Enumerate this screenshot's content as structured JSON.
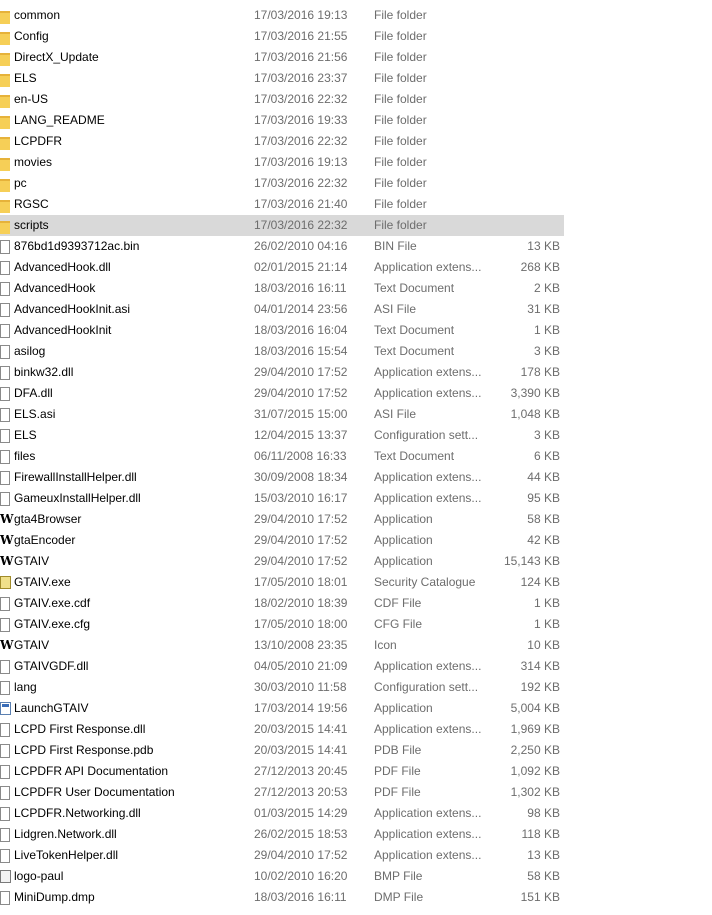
{
  "files": [
    {
      "name": "common",
      "date": "17/03/2016 19:13",
      "type": "File folder",
      "size": "",
      "icon": "folder-icon"
    },
    {
      "name": "Config",
      "date": "17/03/2016 21:55",
      "type": "File folder",
      "size": "",
      "icon": "folder-icon"
    },
    {
      "name": "DirectX_Update",
      "date": "17/03/2016 21:56",
      "type": "File folder",
      "size": "",
      "icon": "folder-icon"
    },
    {
      "name": "ELS",
      "date": "17/03/2016 23:37",
      "type": "File folder",
      "size": "",
      "icon": "folder-icon"
    },
    {
      "name": "en-US",
      "date": "17/03/2016 22:32",
      "type": "File folder",
      "size": "",
      "icon": "folder-icon"
    },
    {
      "name": "LANG_README",
      "date": "17/03/2016 19:33",
      "type": "File folder",
      "size": "",
      "icon": "folder-icon"
    },
    {
      "name": "LCPDFR",
      "date": "17/03/2016 22:32",
      "type": "File folder",
      "size": "",
      "icon": "folder-icon"
    },
    {
      "name": "movies",
      "date": "17/03/2016 19:13",
      "type": "File folder",
      "size": "",
      "icon": "folder-icon"
    },
    {
      "name": "pc",
      "date": "17/03/2016 22:32",
      "type": "File folder",
      "size": "",
      "icon": "folder-icon"
    },
    {
      "name": "RGSC",
      "date": "17/03/2016 21:40",
      "type": "File folder",
      "size": "",
      "icon": "folder-icon"
    },
    {
      "name": "scripts",
      "date": "17/03/2016 22:32",
      "type": "File folder",
      "size": "",
      "icon": "folder-icon",
      "selected": true
    },
    {
      "name": "876bd1d9393712ac.bin",
      "date": "26/02/2010 04:16",
      "type": "BIN File",
      "size": "13 KB",
      "icon": "file-icon"
    },
    {
      "name": "AdvancedHook.dll",
      "date": "02/01/2015 21:14",
      "type": "Application extens...",
      "size": "268 KB",
      "icon": "file-icon"
    },
    {
      "name": "AdvancedHook",
      "date": "18/03/2016 16:11",
      "type": "Text Document",
      "size": "2 KB",
      "icon": "file-icon"
    },
    {
      "name": "AdvancedHookInit.asi",
      "date": "04/01/2014 23:56",
      "type": "ASI File",
      "size": "31 KB",
      "icon": "file-icon"
    },
    {
      "name": "AdvancedHookInit",
      "date": "18/03/2016 16:04",
      "type": "Text Document",
      "size": "1 KB",
      "icon": "file-icon"
    },
    {
      "name": "asilog",
      "date": "18/03/2016 15:54",
      "type": "Text Document",
      "size": "3 KB",
      "icon": "file-icon"
    },
    {
      "name": "binkw32.dll",
      "date": "29/04/2010 17:52",
      "type": "Application extens...",
      "size": "178 KB",
      "icon": "file-icon"
    },
    {
      "name": "DFA.dll",
      "date": "29/04/2010 17:52",
      "type": "Application extens...",
      "size": "3,390 KB",
      "icon": "file-icon"
    },
    {
      "name": "ELS.asi",
      "date": "31/07/2015 15:00",
      "type": "ASI File",
      "size": "1,048 KB",
      "icon": "file-icon"
    },
    {
      "name": "ELS",
      "date": "12/04/2015 13:37",
      "type": "Configuration sett...",
      "size": "3 KB",
      "icon": "file-icon"
    },
    {
      "name": "files",
      "date": "06/11/2008 16:33",
      "type": "Text Document",
      "size": "6 KB",
      "icon": "file-icon"
    },
    {
      "name": "FirewallInstallHelper.dll",
      "date": "30/09/2008 18:34",
      "type": "Application extens...",
      "size": "44 KB",
      "icon": "file-icon"
    },
    {
      "name": "GameuxInstallHelper.dll",
      "date": "15/03/2010 16:17",
      "type": "Application extens...",
      "size": "95 KB",
      "icon": "file-icon"
    },
    {
      "name": "gta4Browser",
      "date": "29/04/2010 17:52",
      "type": "Application",
      "size": "58 KB",
      "icon": "gta-app-icon"
    },
    {
      "name": "gtaEncoder",
      "date": "29/04/2010 17:52",
      "type": "Application",
      "size": "42 KB",
      "icon": "gta-app-icon"
    },
    {
      "name": "GTAIV",
      "date": "29/04/2010 17:52",
      "type": "Application",
      "size": "15,143 KB",
      "icon": "gta-app-icon"
    },
    {
      "name": "GTAIV.exe",
      "date": "17/05/2010 18:01",
      "type": "Security Catalogue",
      "size": "124 KB",
      "icon": "security-catalogue-icon"
    },
    {
      "name": "GTAIV.exe.cdf",
      "date": "18/02/2010 18:39",
      "type": "CDF File",
      "size": "1 KB",
      "icon": "file-icon"
    },
    {
      "name": "GTAIV.exe.cfg",
      "date": "17/05/2010 18:00",
      "type": "CFG File",
      "size": "1 KB",
      "icon": "file-icon"
    },
    {
      "name": "GTAIV",
      "date": "13/10/2008 23:35",
      "type": "Icon",
      "size": "10 KB",
      "icon": "gta-app-icon"
    },
    {
      "name": "GTAIVGDF.dll",
      "date": "04/05/2010 21:09",
      "type": "Application extens...",
      "size": "314 KB",
      "icon": "file-icon"
    },
    {
      "name": "lang",
      "date": "30/03/2010 11:58",
      "type": "Configuration sett...",
      "size": "192 KB",
      "icon": "file-icon"
    },
    {
      "name": "LaunchGTAIV",
      "date": "17/03/2014 19:56",
      "type": "Application",
      "size": "5,004 KB",
      "icon": "launcher-app-icon"
    },
    {
      "name": "LCPD First Response.dll",
      "date": "20/03/2015 14:41",
      "type": "Application extens...",
      "size": "1,969 KB",
      "icon": "file-icon"
    },
    {
      "name": "LCPD First Response.pdb",
      "date": "20/03/2015 14:41",
      "type": "PDB File",
      "size": "2,250 KB",
      "icon": "file-icon"
    },
    {
      "name": "LCPDFR API Documentation",
      "date": "27/12/2013 20:45",
      "type": "PDF File",
      "size": "1,092 KB",
      "icon": "file-icon"
    },
    {
      "name": "LCPDFR User Documentation",
      "date": "27/12/2013 20:53",
      "type": "PDF File",
      "size": "1,302 KB",
      "icon": "file-icon"
    },
    {
      "name": "LCPDFR.Networking.dll",
      "date": "01/03/2015 14:29",
      "type": "Application extens...",
      "size": "98 KB",
      "icon": "file-icon"
    },
    {
      "name": "Lidgren.Network.dll",
      "date": "26/02/2015 18:53",
      "type": "Application extens...",
      "size": "118 KB",
      "icon": "file-icon"
    },
    {
      "name": "LiveTokenHelper.dll",
      "date": "29/04/2010 17:52",
      "type": "Application extens...",
      "size": "13 KB",
      "icon": "file-icon"
    },
    {
      "name": "logo-paul",
      "date": "10/02/2010 16:20",
      "type": "BMP File",
      "size": "58 KB",
      "icon": "bitmap-image-icon"
    },
    {
      "name": "MiniDump.dmp",
      "date": "18/03/2016 16:11",
      "type": "DMP File",
      "size": "151 KB",
      "icon": "file-icon"
    }
  ]
}
